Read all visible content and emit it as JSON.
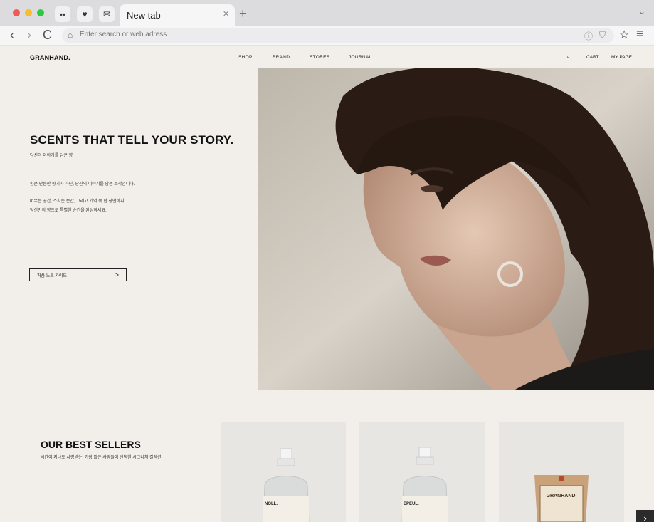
{
  "browser": {
    "tab_title": "New tab",
    "tab_close": "×",
    "new_tab": "+",
    "tab_list": "⌄",
    "url_placeholder": "Enter search or web adress",
    "back": "‹",
    "forward": "›",
    "reload": "C",
    "star": "☆",
    "menu": "≡"
  },
  "site": {
    "logo": "GRANHAND.",
    "nav": [
      "SHOP",
      "BRAND",
      "STORES",
      "JOURNAL"
    ],
    "cart": "CART",
    "my_page": "MY PAGE"
  },
  "hero": {
    "title": "SCENTS THAT TELL YOUR STORY.",
    "subtitle": "당신의 이야기를 담은 향",
    "paragraph1": "향은 단순한 향기가 아닌, 당신의 이야기를 담은 조각입니다.",
    "paragraph2_line1": "머무는 공간, 스치는 순간, 그리고 기억 속 한 장면까지.",
    "paragraph2_line2": "당신만의 향으로 특별한 순간을 완성하세요.",
    "cta_label": "퍼퓸 노트 가이드",
    "cta_arrow": ">",
    "slides": 4,
    "active_slide": 1
  },
  "best_sellers": {
    "title": "OUR BEST SELLERS",
    "subtitle": "시간이 지나도 사랑받는, 가장 많은 사람들이 선택한 시그니처 컬렉션.",
    "products": [
      {
        "label": "NOLL."
      },
      {
        "label": "EPEUL."
      },
      {
        "label": "GRANHAND."
      }
    ],
    "next": "›"
  },
  "colors": {
    "page_bg": "#f2efea",
    "text": "#111111",
    "hero_photo_bg": "#cfc9bf"
  }
}
